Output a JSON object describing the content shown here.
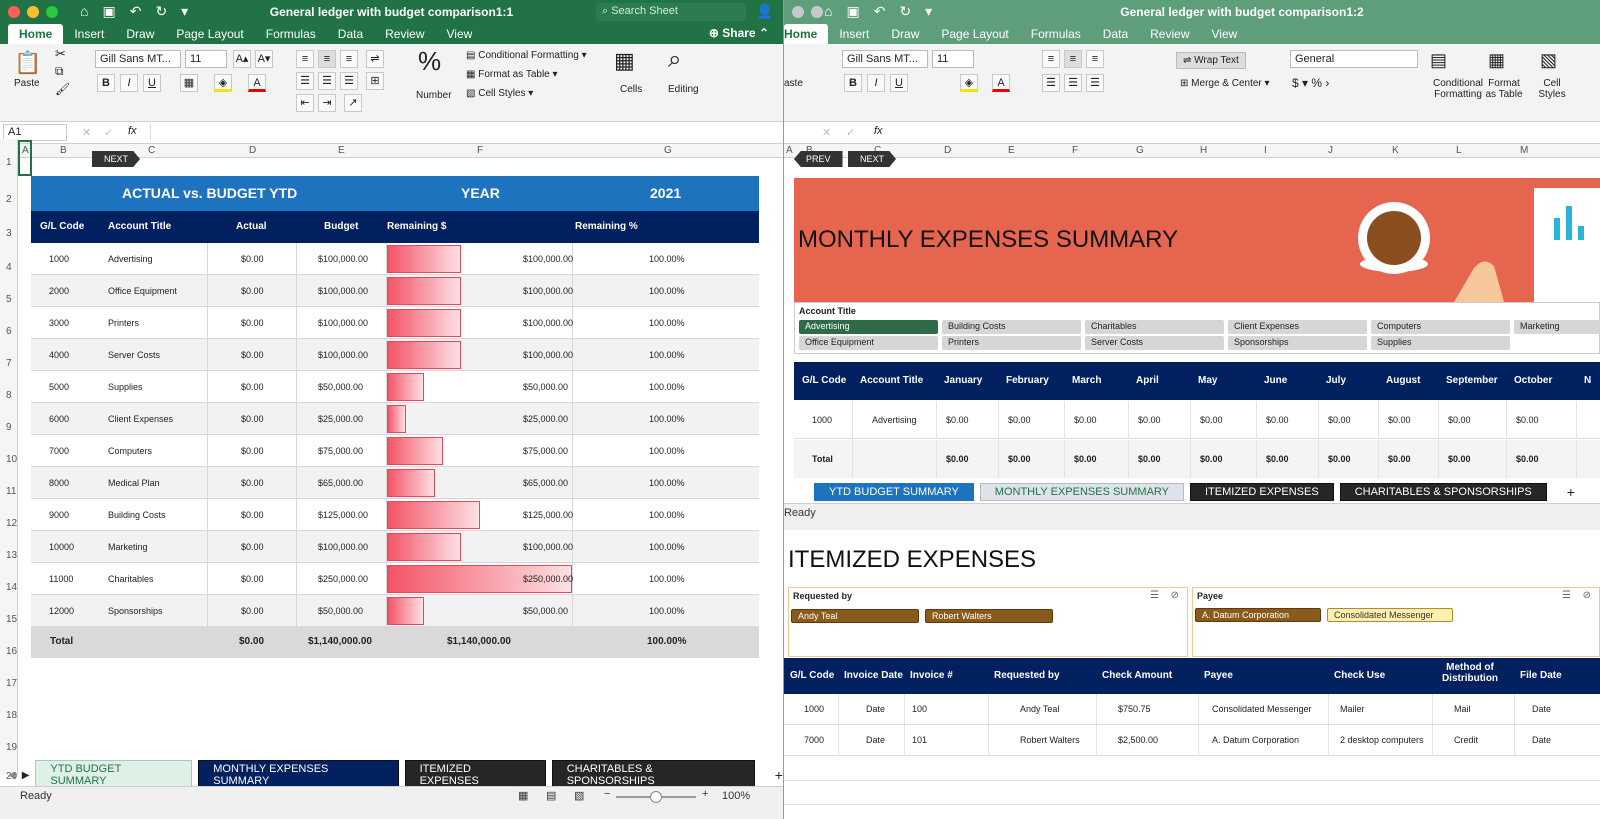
{
  "win1": {
    "title": "General ledger with budget comparison1:1",
    "search_placeholder": "Search Sheet",
    "share": "Share",
    "tabs": [
      "Home",
      "Insert",
      "Draw",
      "Page Layout",
      "Formulas",
      "Data",
      "Review",
      "View"
    ],
    "ribbon": {
      "paste": "Paste",
      "font": "Gill Sans MT...",
      "size": "11",
      "bold": "B",
      "italic": "I",
      "underline": "U",
      "grow": "A▴",
      "shrink": "A▾",
      "number": "Number",
      "percent": "%",
      "cond_format": "Conditional Formatting",
      "format_table": "Format as Table",
      "cell_styles": "Cell Styles",
      "cells": "Cells",
      "editing": "Editing"
    },
    "name_box": "A1",
    "fx": "fx",
    "columns": [
      "A",
      "B",
      "C",
      "D",
      "E",
      "F",
      "G"
    ],
    "rows": [
      "1",
      "2",
      "3",
      "4",
      "5",
      "6",
      "7",
      "8",
      "9",
      "10",
      "11",
      "12",
      "13",
      "14",
      "15",
      "16",
      "17",
      "18",
      "19",
      "20"
    ],
    "next_btn": "NEXT",
    "band": {
      "title": "ACTUAL vs. BUDGET YTD",
      "year_label": "YEAR",
      "year": "2021"
    },
    "headers": [
      "G/L Code",
      "Account Title",
      "Actual",
      "Budget",
      "Remaining $",
      "Remaining %"
    ],
    "table": [
      {
        "code": "1000",
        "title": "Advertising",
        "actual": "$0.00",
        "budget": "$100,000.00",
        "rem": "$100,000.00",
        "pct": "100.00%",
        "frac": 0.4
      },
      {
        "code": "2000",
        "title": "Office Equipment",
        "actual": "$0.00",
        "budget": "$100,000.00",
        "rem": "$100,000.00",
        "pct": "100.00%",
        "frac": 0.4
      },
      {
        "code": "3000",
        "title": "Printers",
        "actual": "$0.00",
        "budget": "$100,000.00",
        "rem": "$100,000.00",
        "pct": "100.00%",
        "frac": 0.4
      },
      {
        "code": "4000",
        "title": "Server Costs",
        "actual": "$0.00",
        "budget": "$100,000.00",
        "rem": "$100,000.00",
        "pct": "100.00%",
        "frac": 0.4
      },
      {
        "code": "5000",
        "title": "Supplies",
        "actual": "$0.00",
        "budget": "$50,000.00",
        "rem": "$50,000.00",
        "pct": "100.00%",
        "frac": 0.2
      },
      {
        "code": "6000",
        "title": "Client Expenses",
        "actual": "$0.00",
        "budget": "$25,000.00",
        "rem": "$25,000.00",
        "pct": "100.00%",
        "frac": 0.1
      },
      {
        "code": "7000",
        "title": "Computers",
        "actual": "$0.00",
        "budget": "$75,000.00",
        "rem": "$75,000.00",
        "pct": "100.00%",
        "frac": 0.3
      },
      {
        "code": "8000",
        "title": "Medical Plan",
        "actual": "$0.00",
        "budget": "$65,000.00",
        "rem": "$65,000.00",
        "pct": "100.00%",
        "frac": 0.26
      },
      {
        "code": "9000",
        "title": "Building Costs",
        "actual": "$0.00",
        "budget": "$125,000.00",
        "rem": "$125,000.00",
        "pct": "100.00%",
        "frac": 0.5
      },
      {
        "code": "10000",
        "title": "Marketing",
        "actual": "$0.00",
        "budget": "$100,000.00",
        "rem": "$100,000.00",
        "pct": "100.00%",
        "frac": 0.4
      },
      {
        "code": "11000",
        "title": "Charitables",
        "actual": "$0.00",
        "budget": "$250,000.00",
        "rem": "$250,000.00",
        "pct": "100.00%",
        "frac": 1.0
      },
      {
        "code": "12000",
        "title": "Sponsorships",
        "actual": "$0.00",
        "budget": "$50,000.00",
        "rem": "$50,000.00",
        "pct": "100.00%",
        "frac": 0.2
      }
    ],
    "total": {
      "label": "Total",
      "actual": "$0.00",
      "budget": "$1,140,000.00",
      "rem": "$1,140,000.00",
      "pct": "100.00%"
    },
    "sheet_tabs": [
      "YTD BUDGET SUMMARY",
      "MONTHLY EXPENSES SUMMARY",
      "ITEMIZED EXPENSES",
      "CHARITABLES & SPONSORSHIPS"
    ],
    "add_sheet": "+",
    "status": "Ready",
    "zoom": "100%"
  },
  "win2": {
    "title": "General ledger with budget comparison1:2",
    "tabs": [
      "Home",
      "Insert",
      "Draw",
      "Page Layout",
      "Formulas",
      "Data",
      "Review",
      "View"
    ],
    "ribbon": {
      "paste": "aste",
      "font": "Gill Sans MT...",
      "size": "11",
      "wrap": "Wrap Text",
      "merge": "Merge & Center",
      "number_format": "General",
      "cond_format": "Conditional Formatting",
      "format_table": "Format as Table",
      "cell_styles": "Cell Styles"
    },
    "columns": [
      "A",
      "B",
      "C",
      "D",
      "E",
      "F",
      "G",
      "H",
      "I",
      "J",
      "K",
      "L",
      "M"
    ],
    "prev_btn": "PREV",
    "next_btn": "NEXT",
    "heading": "MONTHLY EXPENSES SUMMARY",
    "slicer_title": "Account Title",
    "slicer_items": [
      "Advertising",
      "Building Costs",
      "Charitables",
      "Client Expenses",
      "Computers",
      "Marketing",
      "Office Equipment",
      "Printers",
      "Server Costs",
      "Sponsorships",
      "Supplies"
    ],
    "headers": [
      "G/L Code",
      "Account Title",
      "January",
      "February",
      "March",
      "April",
      "May",
      "June",
      "July",
      "August",
      "September",
      "October",
      "N"
    ],
    "row": {
      "code": "1000",
      "title": "Advertising",
      "value": "$0.00"
    },
    "total_label": "Total",
    "sheet_tabs": [
      "YTD BUDGET SUMMARY",
      "MONTHLY EXPENSES SUMMARY",
      "ITEMIZED EXPENSES",
      "CHARITABLES & SPONSORSHIPS"
    ],
    "add_sheet": "+",
    "status": "Ready"
  },
  "win3": {
    "heading": "ITEMIZED EXPENSES",
    "slicer1": {
      "title": "Requested by",
      "items": [
        "Andy Teal",
        "Robert Walters"
      ]
    },
    "slicer2": {
      "title": "Payee",
      "items": [
        "A. Datum Corporation",
        "Consolidated Messenger"
      ]
    },
    "headers": [
      "G/L Code",
      "Invoice Date",
      "Invoice #",
      "Requested by",
      "Check Amount",
      "Payee",
      "Check Use",
      "Method of Distribution",
      "File Date"
    ],
    "rows": [
      [
        "1000",
        "Date",
        "100",
        "Andy Teal",
        "$750.75",
        "Consolidated Messenger",
        "Mailer",
        "Mail",
        "Date"
      ],
      [
        "7000",
        "Date",
        "101",
        "Robert Walters",
        "$2,500.00",
        "A. Datum Corporation",
        "2 desktop computers",
        "Credit",
        "Date"
      ]
    ]
  },
  "colors": {
    "excel_green": "#217346",
    "band_blue": "#1e73be",
    "navy": "#002060",
    "orange": "#e5654f",
    "bar_red": "#f35467"
  }
}
